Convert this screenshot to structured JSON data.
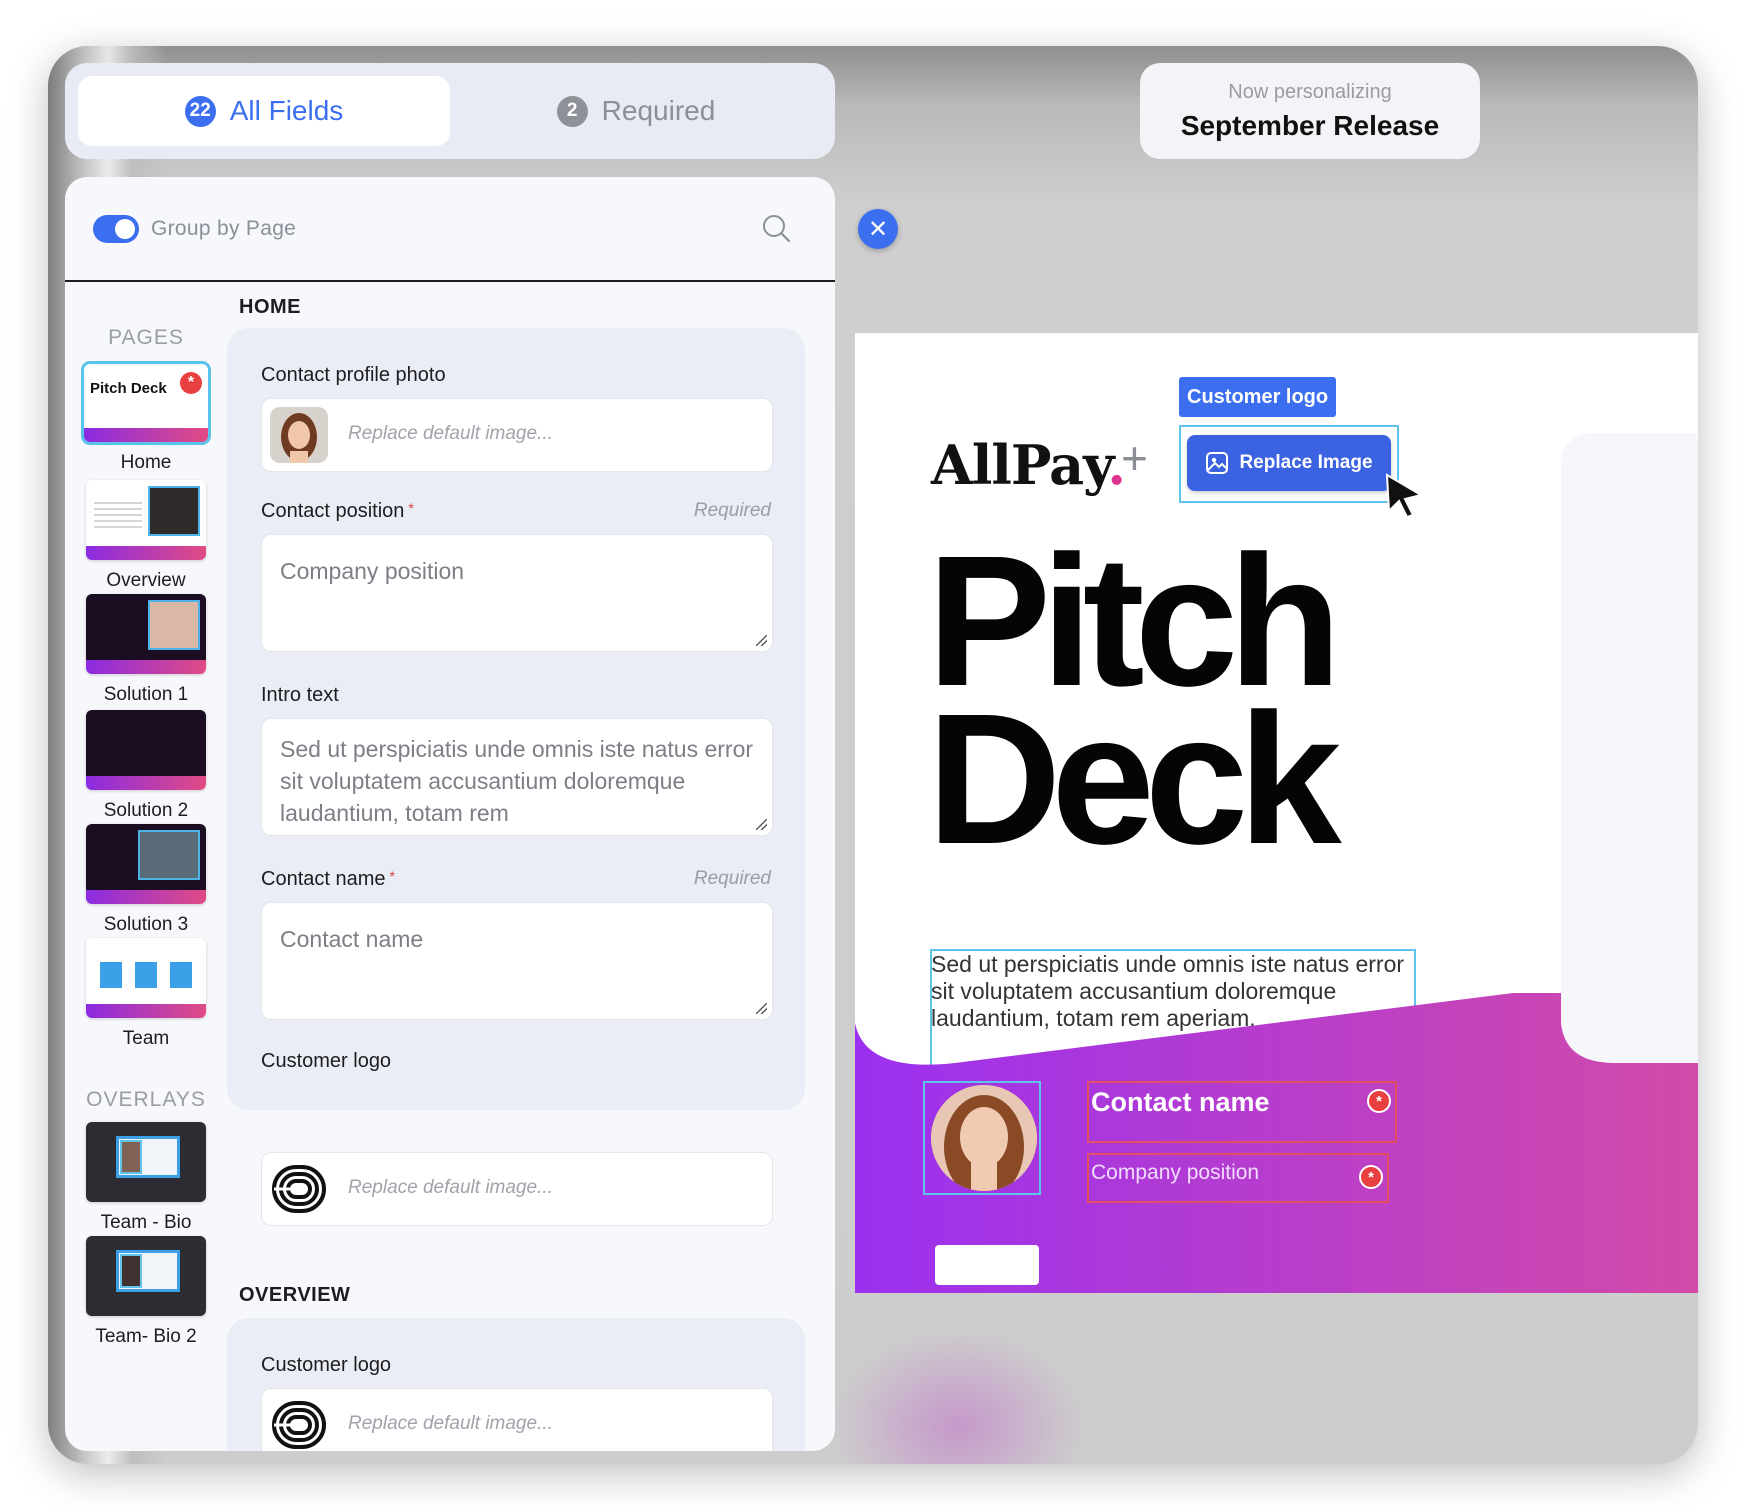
{
  "tabs": {
    "all_fields": {
      "label": "All Fields",
      "count": "22"
    },
    "required": {
      "label": "Required",
      "count": "2"
    }
  },
  "personalizing": {
    "label": "Now personalizing",
    "title": "September Release"
  },
  "panel": {
    "group_by_label": "Group by Page",
    "group_by_enabled": true,
    "pages_header": "PAGES",
    "overlays_header": "OVERLAYS",
    "pages": [
      {
        "label": "Home",
        "thumb_text": "Pitch Deck"
      },
      {
        "label": "Overview"
      },
      {
        "label": "Solution 1"
      },
      {
        "label": "Solution 2"
      },
      {
        "label": "Solution 3"
      },
      {
        "label": "Team"
      }
    ],
    "overlays": [
      {
        "label": "Team - Bio"
      },
      {
        "label": "Team- Bio 2"
      }
    ]
  },
  "sections": {
    "home": {
      "title": "HOME",
      "contact_photo": {
        "label": "Contact profile photo",
        "placeholder": "Replace default image..."
      },
      "contact_position": {
        "label": "Contact position",
        "hint": "Required",
        "placeholder": "Company position"
      },
      "intro_text": {
        "label": "Intro text",
        "placeholder": "Sed ut perspiciatis unde omnis iste natus error sit voluptatem accusantium doloremque laudantium, totam rem"
      },
      "contact_name": {
        "label": "Contact name",
        "hint": "Required",
        "placeholder": "Contact name"
      },
      "customer_logo": {
        "label": "Customer logo",
        "placeholder": "Replace default image..."
      }
    },
    "overview": {
      "title": "OVERVIEW",
      "customer_logo": {
        "label": "Customer logo",
        "placeholder": "Replace default image..."
      }
    }
  },
  "preview": {
    "brand": "AllPay",
    "brand_dot": ".",
    "plus": "+",
    "customer_logo_tag": "Customer logo",
    "replace_button": "Replace Image",
    "headline_line1": "Pitch",
    "headline_line2": "Deck",
    "intro": "Sed ut perspiciatis unde omnis iste natus error sit voluptatem accusantium doloremque laudantium, totam rem aperiam.",
    "contact_name": "Contact name",
    "company_position": "Company position"
  },
  "colors": {
    "accent": "#3b6ff0",
    "required": "#e84040",
    "gradient_start": "#9b30f0",
    "gradient_end": "#d24aa8"
  }
}
